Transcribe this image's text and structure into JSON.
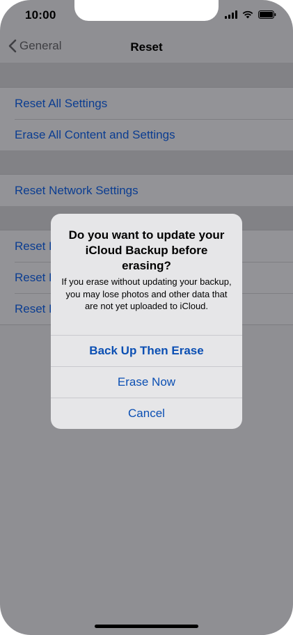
{
  "status_bar": {
    "time": "10:00"
  },
  "nav": {
    "back_label": "General",
    "title": "Reset"
  },
  "groups": [
    {
      "items": [
        "Reset All Settings",
        "Erase All Content and Settings"
      ]
    },
    {
      "items": [
        "Reset Network Settings"
      ]
    },
    {
      "items": [
        "Reset K",
        "Reset H",
        "Reset L"
      ]
    }
  ],
  "alert": {
    "title": "Do you want to update your iCloud Backup before erasing?",
    "message": "If you erase without updating your backup, you may lose photos and other data that are not yet uploaded to iCloud.",
    "buttons": {
      "backup": "Back Up Then Erase",
      "erase": "Erase Now",
      "cancel": "Cancel"
    }
  },
  "colors": {
    "overlay": "#8f8f93",
    "link": "#0b4fb3",
    "alert_bg": "#e6e6e8"
  }
}
